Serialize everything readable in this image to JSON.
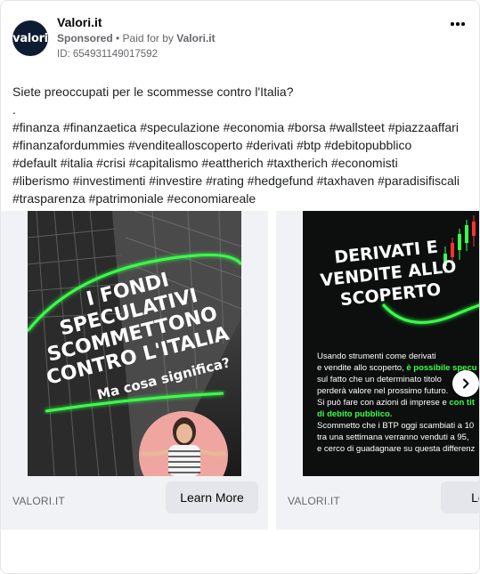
{
  "post": {
    "page_name": "Valori.it",
    "avatar_text": "valori",
    "sponsored": "Sponsored",
    "paid_for_prefix": "• Paid for by",
    "paid_for_name": "Valori.it",
    "ad_id": "ID: 654931149017592",
    "more_icon": "more-options-icon",
    "body": {
      "question": "Siete preoccupati per le scommesse contro l'Italia?",
      "dot": ".",
      "hashtags_1": "#finanza #finanzaetica #speculazione #economia #borsa #wallsteet #piazzaaffari",
      "hashtags_2": "#finanzafordummies #venditealloscoperto #derivati #btp #debitopubblico",
      "hashtags_3": "#default #italia #crisi #capitalismo #eattherich #taxtherich #economisti",
      "hashtags_4": "#liberismo #investimenti #investire #rating #hedgefund #taxhaven #paradisifiscali",
      "hashtags_5": "#trasparenza #patrimoniale #economiareale"
    }
  },
  "carousel": {
    "slides": [
      {
        "headline_lines": [
          "I FONDI",
          "SPECULATIVI",
          "SCOMMETTONO",
          "CONTRO L'ITALIA"
        ],
        "subtitle": "Ma cosa significa?",
        "domain": "VALORI.IT",
        "cta": "Learn More"
      },
      {
        "headline_lines": [
          "DERIVATI E",
          "VENDITE ALLO",
          "SCOPERTO"
        ],
        "text_lines": [
          "Usando strumenti come derivati",
          "e vendite allo scoperto,",
          "sul fatto che un determinato titolo",
          "perderà valore nel prossimo futuro.",
          "Si può fare con azioni di imprese e",
          "di debito pubblico.",
          "Scommetto che i BTP oggi scambiati a 10",
          "tra una settimana verranno venduti a 95,",
          "e cerco di guadagnare su questa differenz"
        ],
        "highlight_1": "è possibile specu",
        "highlight_2": "con tit",
        "domain": "VALORI.IT",
        "cta": "Learn"
      }
    ],
    "next_icon": "chevron-right-icon"
  },
  "colors": {
    "neon_green": "#39ff4a",
    "dark_bg": "#111111",
    "avatar_bg": "#0e1c33",
    "cta_bg": "#e4e6eb"
  }
}
